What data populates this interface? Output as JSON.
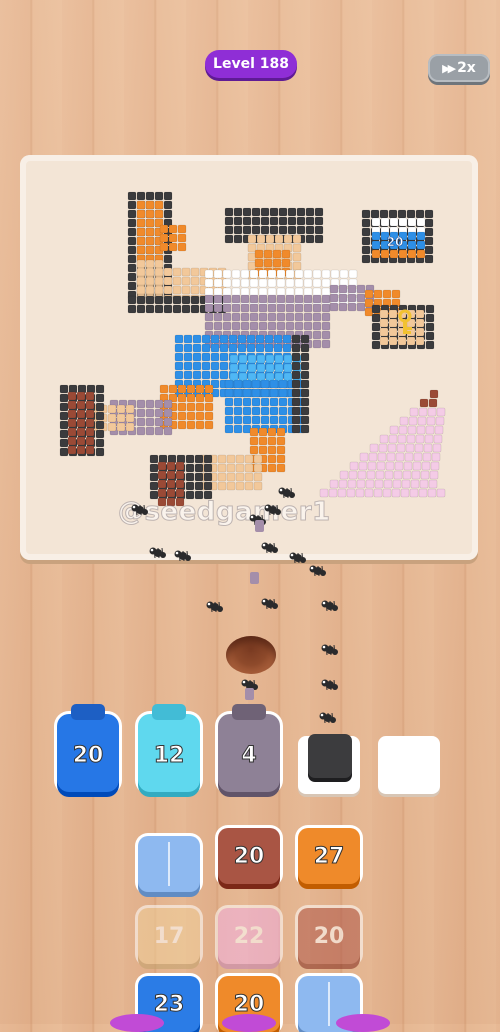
{
  "header": {
    "level_label": "Level 188",
    "speed_label": "2x",
    "speed_icon": "fast-forward-icon"
  },
  "board": {
    "watermark": "@seedgamer1",
    "badge_number": "20",
    "key_icon": "key-icon",
    "colors": {
      "orange": "#f08a2b",
      "dark": "#3b3b3d",
      "skin": "#f2c89a",
      "white": "#ffffff",
      "lavender": "#a48eaa",
      "blue": "#2e8fe6",
      "light_blue": "#4fb7f5",
      "brown": "#9a4a36",
      "pink": "#f4cbe6",
      "gold": "#f2c230"
    }
  },
  "collectors": [
    {
      "value": "20",
      "color": "#2677e6",
      "lid": "#1d5fc4",
      "type": "jar"
    },
    {
      "value": "12",
      "color": "#5fd8ee",
      "lid": "#42bcd6",
      "type": "jar"
    },
    {
      "value": "4",
      "color": "#8e8196",
      "lid": "#6f6276",
      "type": "jar"
    },
    {
      "value": "",
      "color": "#3c3c3e",
      "type": "slot"
    },
    {
      "value": "",
      "color": "#ffffff",
      "type": "slot"
    }
  ],
  "stock": [
    {
      "value": "",
      "color": "#8eb9f0",
      "faded": false,
      "split": true
    },
    {
      "value": "20",
      "color": "#a95544",
      "faded": false,
      "split": false
    },
    {
      "value": "27",
      "color": "#ef8a2a",
      "faded": false,
      "split": false
    },
    {
      "value": "17",
      "color": "#f0cf9a",
      "faded": true,
      "split": false
    },
    {
      "value": "22",
      "color": "#f2b0e2",
      "faded": true,
      "split": false
    },
    {
      "value": "20",
      "color": "#b0584a",
      "faded": true,
      "split": false
    },
    {
      "value": "23",
      "color": "#2b7ce6",
      "faded": false,
      "split": false
    },
    {
      "value": "20",
      "color": "#ef8a2a",
      "faded": false,
      "split": false
    },
    {
      "value": "",
      "color": "#8eb9f0",
      "faded": false,
      "split": true
    }
  ]
}
